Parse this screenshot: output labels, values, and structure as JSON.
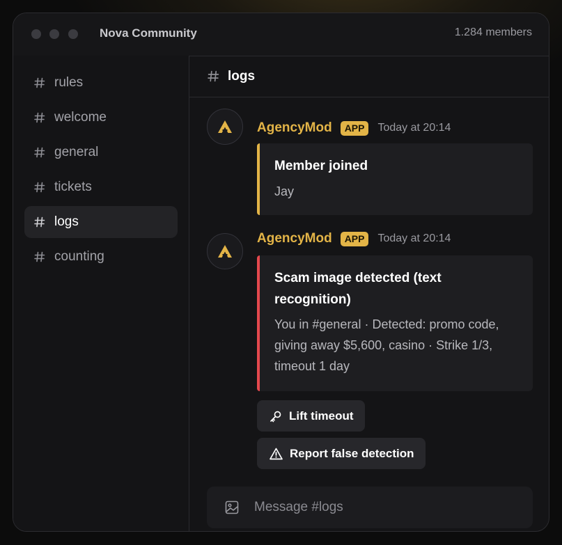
{
  "window": {
    "title": "Nova Community",
    "members": "1.284 members"
  },
  "sidebar": {
    "channels": [
      {
        "label": "rules",
        "active": false
      },
      {
        "label": "welcome",
        "active": false
      },
      {
        "label": "general",
        "active": false
      },
      {
        "label": "tickets",
        "active": false
      },
      {
        "label": "logs",
        "active": true
      },
      {
        "label": "counting",
        "active": false
      }
    ]
  },
  "channel": {
    "name": "logs"
  },
  "messages": [
    {
      "author": "AgencyMod",
      "badge": "APP",
      "time": "Today at 20:14",
      "embed": {
        "title": "Member joined",
        "description": "Jay",
        "accent": "#e3b447"
      }
    },
    {
      "author": "AgencyMod",
      "badge": "APP",
      "time": "Today at 20:14",
      "embed": {
        "title": "Scam image detected (text recognition)",
        "description": "You in #general · Detected: promo code, giving away $5,600, casino · Strike 1/3, timeout 1 day",
        "accent": "#e5484d"
      },
      "buttons": [
        {
          "label": "Lift timeout",
          "icon": "key-icon"
        },
        {
          "label": "Report false detection",
          "icon": "warning-icon"
        }
      ]
    }
  ],
  "composer": {
    "placeholder": "Message #logs",
    "icon": "image-icon"
  },
  "colors": {
    "accent": "#e3b447",
    "danger": "#e5484d"
  }
}
